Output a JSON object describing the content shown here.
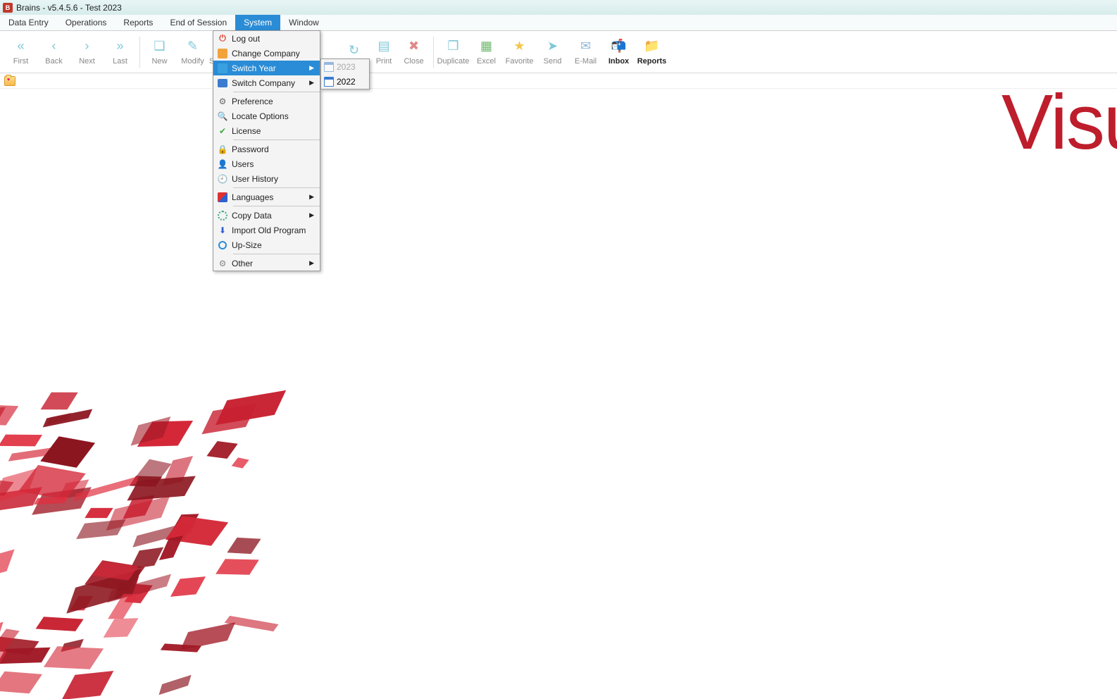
{
  "title": "Brains - v5.4.5.6 - Test 2023",
  "menubar": [
    "Data Entry",
    "Operations",
    "Reports",
    "End of Session",
    "System",
    "Window"
  ],
  "menubar_active_index": 4,
  "toolbar": [
    {
      "label": "First",
      "icon": "«",
      "color": "#7fc8d8",
      "sep": false
    },
    {
      "label": "Back",
      "icon": "‹",
      "color": "#7fc8d8",
      "sep": false
    },
    {
      "label": "Next",
      "icon": "›",
      "color": "#7fc8d8",
      "sep": false
    },
    {
      "label": "Last",
      "icon": "»",
      "color": "#7fc8d8",
      "sep": true
    },
    {
      "label": "New",
      "icon": "❏",
      "color": "#7fc8d8",
      "sep": false
    },
    {
      "label": "Modify",
      "icon": "✎",
      "color": "#7fc8d8",
      "sep": false
    },
    {
      "label": "Save",
      "icon": "✔",
      "color": "#7fc8d8",
      "sep": false,
      "partial": true
    },
    {
      "label": "",
      "icon": "",
      "color": "",
      "sep": false,
      "spacer": 152
    },
    {
      "label": "",
      "icon": "↻",
      "color": "#7fc8d8",
      "sep": false,
      "nolabel": true
    },
    {
      "label": "Print",
      "icon": "▤",
      "color": "#7fc8d8",
      "sep": false,
      "partial_left": true
    },
    {
      "label": "Close",
      "icon": "✖",
      "color": "#e08a8a",
      "sep": true
    },
    {
      "label": "Duplicate",
      "icon": "❐",
      "color": "#7fc8d8",
      "sep": false
    },
    {
      "label": "Excel",
      "icon": "▦",
      "color": "#6fb96f",
      "sep": false
    },
    {
      "label": "Favorite",
      "icon": "★",
      "color": "#f3c64b",
      "sep": false
    },
    {
      "label": "Send",
      "icon": "➤",
      "color": "#7fc8d8",
      "sep": false
    },
    {
      "label": "E-Mail",
      "icon": "✉",
      "color": "#8fb8d8",
      "sep": false
    },
    {
      "label": "Inbox",
      "icon": "📬",
      "color": "",
      "sep": false,
      "enabled": true
    },
    {
      "label": "Reports",
      "icon": "📁",
      "color": "",
      "sep": false,
      "enabled": true
    }
  ],
  "dropdown": {
    "groups": [
      [
        {
          "label": "Log out",
          "icon": "power"
        },
        {
          "label": "Change Company",
          "icon": "orange"
        },
        {
          "label": "Switch Year",
          "icon": "blue",
          "submenu": true,
          "highlight": true
        },
        {
          "label": "Switch Company",
          "icon": "bluecase",
          "submenu": true
        }
      ],
      [
        {
          "label": "Preference",
          "icon": "gear"
        },
        {
          "label": "Locate Options",
          "icon": "mag"
        },
        {
          "label": "License",
          "icon": "check"
        }
      ],
      [
        {
          "label": "Password",
          "icon": "lock"
        },
        {
          "label": "Users",
          "icon": "user"
        },
        {
          "label": "User History",
          "icon": "clock"
        }
      ],
      [
        {
          "label": "Languages",
          "icon": "lang",
          "submenu": true
        }
      ],
      [
        {
          "label": "Copy Data",
          "icon": "copy",
          "submenu": true
        },
        {
          "label": "Import Old Program",
          "icon": "down"
        },
        {
          "label": "Up-Size",
          "icon": "up"
        }
      ],
      [
        {
          "label": "Other",
          "icon": "other",
          "submenu": true
        }
      ]
    ]
  },
  "submenu_switch_year": [
    {
      "label": "2023",
      "disabled": true
    },
    {
      "label": "2022",
      "disabled": false
    }
  ],
  "watermark": "Visu"
}
